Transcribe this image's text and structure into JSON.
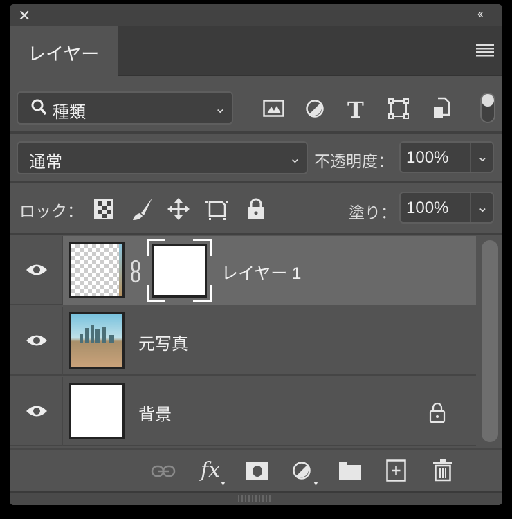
{
  "panel": {
    "tab_label": "レイヤー",
    "close_icon": "close-icon",
    "collapse_label": "‹‹"
  },
  "filter": {
    "kind_label": "種類"
  },
  "blend": {
    "mode": "通常",
    "opacity_label": "不透明度：",
    "opacity_value": "100%"
  },
  "lock": {
    "label": "ロック：",
    "fill_label": "塗り：",
    "fill_value": "100%"
  },
  "layers": [
    {
      "name": "レイヤー 1",
      "selected": true,
      "has_mask": true,
      "locked": false
    },
    {
      "name": "元写真",
      "selected": false,
      "has_mask": false,
      "locked": false
    },
    {
      "name": "背景",
      "selected": false,
      "has_mask": false,
      "locked": true
    }
  ],
  "footer": {
    "fx_label": "fx"
  },
  "colors": {
    "panel": "#535353",
    "selected_row": "#696969",
    "field": "#404040"
  }
}
